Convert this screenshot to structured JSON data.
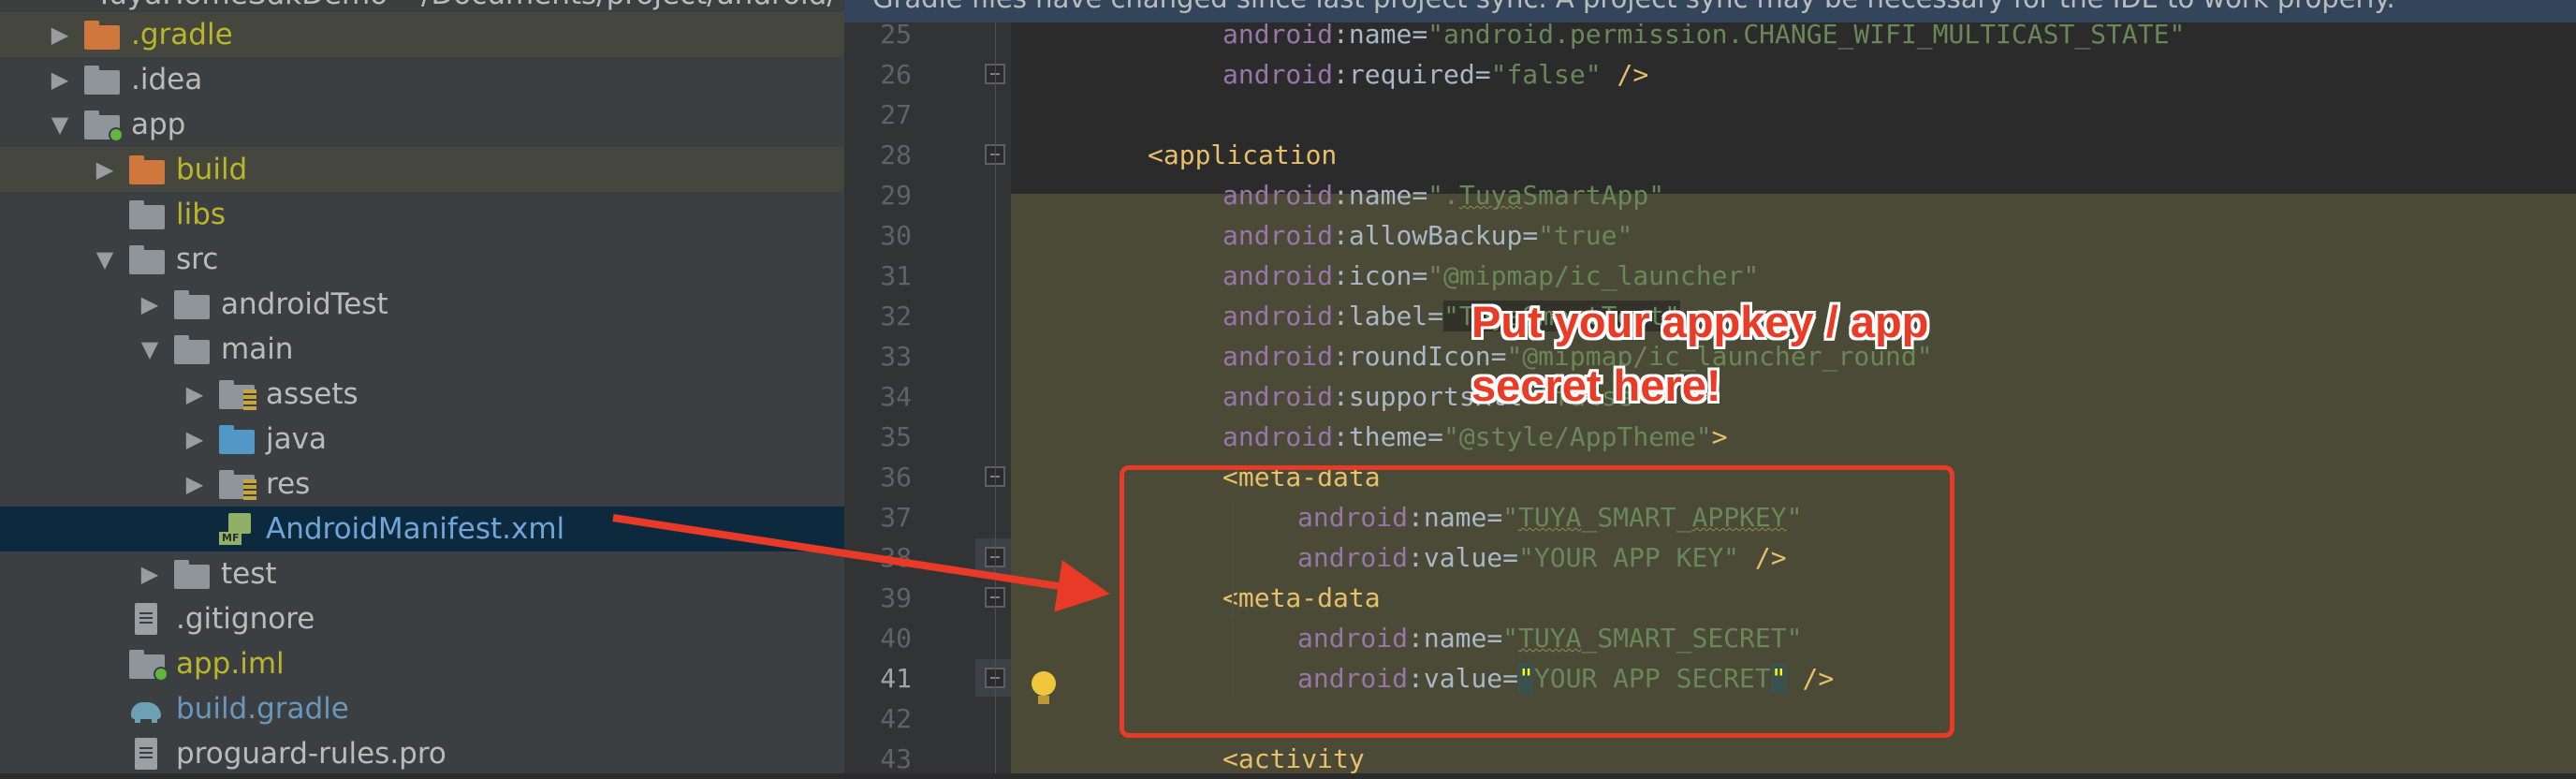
{
  "sync_message": "Gradle files have changed since last project sync. A project sync may be necessary for the IDE to work properly.",
  "tree": {
    "root_partial": "TuyaHomeSdkDemo ~/Documents/project/android/",
    "items": [
      {
        "label": ".gradle",
        "icon": "folder-orange",
        "color": "olive",
        "arrow": "collapsed",
        "indent": 0,
        "highlight": "gray"
      },
      {
        "label": ".idea",
        "icon": "folder-gray",
        "color": "default",
        "arrow": "collapsed",
        "indent": 0,
        "highlight": ""
      },
      {
        "label": "app",
        "icon": "module-folder",
        "color": "default",
        "arrow": "expanded",
        "indent": 0,
        "highlight": ""
      },
      {
        "label": "build",
        "icon": "folder-orange",
        "color": "olive",
        "arrow": "collapsed",
        "indent": 1,
        "highlight": "gray"
      },
      {
        "label": "libs",
        "icon": "folder-gray",
        "color": "olive",
        "arrow": "none",
        "indent": 1,
        "highlight": ""
      },
      {
        "label": "src",
        "icon": "folder-gray",
        "color": "default",
        "arrow": "expanded",
        "indent": 1,
        "highlight": ""
      },
      {
        "label": "androidTest",
        "icon": "folder-gray",
        "color": "default",
        "arrow": "collapsed",
        "indent": 2,
        "highlight": ""
      },
      {
        "label": "main",
        "icon": "folder-gray",
        "color": "default",
        "arrow": "expanded",
        "indent": 2,
        "highlight": ""
      },
      {
        "label": "assets",
        "icon": "folder-res",
        "color": "default",
        "arrow": "collapsed",
        "indent": 3,
        "highlight": ""
      },
      {
        "label": "java",
        "icon": "folder-blue",
        "color": "default",
        "arrow": "collapsed",
        "indent": 3,
        "highlight": ""
      },
      {
        "label": "res",
        "icon": "folder-res",
        "color": "default",
        "arrow": "collapsed",
        "indent": 3,
        "highlight": ""
      },
      {
        "label": "AndroidManifest.xml",
        "icon": "manifest-file",
        "color": "selected",
        "arrow": "none",
        "indent": 3,
        "highlight": "selected"
      },
      {
        "label": "test",
        "icon": "folder-gray",
        "color": "default",
        "arrow": "collapsed",
        "indent": 2,
        "highlight": ""
      },
      {
        "label": ".gitignore",
        "icon": "text-file",
        "color": "default",
        "arrow": "none",
        "indent": 1,
        "highlight": ""
      },
      {
        "label": "app.iml",
        "icon": "module-file",
        "color": "olive",
        "arrow": "none",
        "indent": 1,
        "highlight": ""
      },
      {
        "label": "build.gradle",
        "icon": "gradle-file",
        "color": "blue",
        "arrow": "none",
        "indent": 1,
        "highlight": ""
      },
      {
        "label": "proguard-rules.pro",
        "icon": "text-file",
        "color": "default",
        "arrow": "none",
        "indent": 1,
        "highlight": ""
      }
    ]
  },
  "editor": {
    "current_line": "41",
    "lines": [
      {
        "no": "25",
        "indent": 2,
        "tokens": [
          {
            "t": "attr",
            "v": "android"
          },
          {
            "t": "punc",
            "v": ":"
          },
          {
            "t": "plain",
            "v": "name"
          },
          {
            "t": "eq",
            "v": "="
          },
          {
            "t": "val",
            "v": "\"android.permission.CHANGE_WIFI_MULTICAST_STATE\""
          }
        ]
      },
      {
        "no": "26",
        "indent": 2,
        "tokens": [
          {
            "t": "attr",
            "v": "android"
          },
          {
            "t": "punc",
            "v": ":"
          },
          {
            "t": "plain",
            "v": "required"
          },
          {
            "t": "eq",
            "v": "="
          },
          {
            "t": "val",
            "v": "\"false\""
          },
          {
            "t": "tag",
            "v": " />"
          }
        ]
      },
      {
        "no": "27",
        "indent": 0,
        "tokens": []
      },
      {
        "no": "28",
        "indent": 1,
        "tokens": [
          {
            "t": "tag",
            "v": "<application"
          }
        ]
      },
      {
        "no": "29",
        "indent": 2,
        "tokens": [
          {
            "t": "attr",
            "v": "android"
          },
          {
            "t": "punc",
            "v": ":"
          },
          {
            "t": "plain",
            "v": "name"
          },
          {
            "t": "eq",
            "v": "="
          },
          {
            "t": "val",
            "v": "\"."
          },
          {
            "t": "val-squig",
            "v": "Tuya"
          },
          {
            "t": "val",
            "v": "SmartApp\""
          }
        ]
      },
      {
        "no": "30",
        "indent": 2,
        "tokens": [
          {
            "t": "attr",
            "v": "android"
          },
          {
            "t": "punc",
            "v": ":"
          },
          {
            "t": "plain",
            "v": "allowBackup"
          },
          {
            "t": "eq",
            "v": "="
          },
          {
            "t": "val",
            "v": "\"true\""
          }
        ]
      },
      {
        "no": "31",
        "indent": 2,
        "tokens": [
          {
            "t": "attr",
            "v": "android"
          },
          {
            "t": "punc",
            "v": ":"
          },
          {
            "t": "plain",
            "v": "icon"
          },
          {
            "t": "eq",
            "v": "="
          },
          {
            "t": "val",
            "v": "\"@mipmap/ic_launcher\""
          }
        ]
      },
      {
        "no": "32",
        "indent": 2,
        "tokens": [
          {
            "t": "attr",
            "v": "android"
          },
          {
            "t": "punc",
            "v": ":"
          },
          {
            "t": "plain",
            "v": "label"
          },
          {
            "t": "eq",
            "v": "="
          },
          {
            "t": "label-hl",
            "v": "\"TuyaSmartTest\""
          }
        ]
      },
      {
        "no": "33",
        "indent": 2,
        "tokens": [
          {
            "t": "attr",
            "v": "android"
          },
          {
            "t": "punc",
            "v": ":"
          },
          {
            "t": "plain",
            "v": "roundIcon"
          },
          {
            "t": "eq",
            "v": "="
          },
          {
            "t": "val",
            "v": "\"@mipmap/ic_launcher_round\""
          }
        ]
      },
      {
        "no": "34",
        "indent": 2,
        "tokens": [
          {
            "t": "attr",
            "v": "android"
          },
          {
            "t": "punc",
            "v": ":"
          },
          {
            "t": "plain",
            "v": "supportsRtl"
          },
          {
            "t": "eq",
            "v": "="
          },
          {
            "t": "val",
            "v": "\"false\""
          }
        ]
      },
      {
        "no": "35",
        "indent": 2,
        "tokens": [
          {
            "t": "attr",
            "v": "android"
          },
          {
            "t": "punc",
            "v": ":"
          },
          {
            "t": "plain",
            "v": "theme"
          },
          {
            "t": "eq",
            "v": "="
          },
          {
            "t": "val",
            "v": "\"@style/AppTheme\""
          },
          {
            "t": "tag",
            "v": ">"
          }
        ]
      },
      {
        "no": "36",
        "indent": 2,
        "tokens": [
          {
            "t": "tag",
            "v": "<meta-data"
          }
        ]
      },
      {
        "no": "37",
        "indent": 3,
        "tokens": [
          {
            "t": "attr",
            "v": "android"
          },
          {
            "t": "punc",
            "v": ":"
          },
          {
            "t": "plain",
            "v": "name"
          },
          {
            "t": "eq",
            "v": "="
          },
          {
            "t": "val",
            "v": "\""
          },
          {
            "t": "val-squig",
            "v": "TUYA"
          },
          {
            "t": "val",
            "v": "_SMART_"
          },
          {
            "t": "val-squig",
            "v": "APPKEY"
          },
          {
            "t": "val",
            "v": "\""
          }
        ]
      },
      {
        "no": "38",
        "indent": 3,
        "tokens": [
          {
            "t": "attr",
            "v": "android"
          },
          {
            "t": "punc",
            "v": ":"
          },
          {
            "t": "plain",
            "v": "value"
          },
          {
            "t": "eq",
            "v": "="
          },
          {
            "t": "val",
            "v": "\"YOUR APP KEY\""
          },
          {
            "t": "tag",
            "v": " />"
          }
        ]
      },
      {
        "no": "39",
        "indent": 2,
        "tokens": [
          {
            "t": "tag",
            "v": "<meta-data"
          }
        ]
      },
      {
        "no": "40",
        "indent": 3,
        "tokens": [
          {
            "t": "attr",
            "v": "android"
          },
          {
            "t": "punc",
            "v": ":"
          },
          {
            "t": "plain",
            "v": "name"
          },
          {
            "t": "eq",
            "v": "="
          },
          {
            "t": "val",
            "v": "\""
          },
          {
            "t": "val-squig",
            "v": "TUYA"
          },
          {
            "t": "val",
            "v": "_SMART_SECRET\""
          }
        ]
      },
      {
        "no": "41",
        "indent": 3,
        "tokens": [
          {
            "t": "attr",
            "v": "android"
          },
          {
            "t": "punc",
            "v": ":"
          },
          {
            "t": "plain",
            "v": "value"
          },
          {
            "t": "eq",
            "v": "="
          },
          {
            "t": "cursor",
            "v": "\""
          },
          {
            "t": "val",
            "v": "YOUR APP SECRET"
          },
          {
            "t": "cursor",
            "v": "\""
          },
          {
            "t": "tag",
            "v": " />"
          }
        ]
      },
      {
        "no": "42",
        "indent": 0,
        "tokens": []
      },
      {
        "no": "43",
        "indent": 2,
        "tokens": [
          {
            "t": "tag",
            "v": "<activity"
          }
        ]
      }
    ]
  },
  "annotation": {
    "line1": "Put your appkey / app",
    "line2": "secret here!",
    "color": "#e83a26"
  }
}
